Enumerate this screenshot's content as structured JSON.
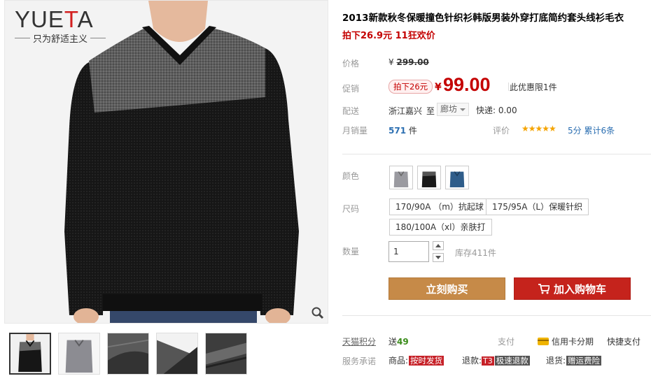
{
  "gallery": {
    "brand_prefix": "YUE",
    "brand_accent": "T",
    "brand_suffix": "A",
    "tagline": "只为舒适主义",
    "zoom_icon": "magnifier-icon",
    "thumbnails": [
      "front-view",
      "grey-sweater",
      "knit-texture-1",
      "knit-texture-2",
      "knit-texture-3"
    ]
  },
  "product": {
    "title": "2013新款秋冬保暖撞色针织衫韩版男装外穿打底简约套头线衫毛衣",
    "promo_line": "拍下26.9元 11狂欢价"
  },
  "price": {
    "label": "价格",
    "currency": "¥",
    "original": "299.00",
    "promo_label": "促销",
    "promo_tag": "拍下26元",
    "current": "99.00",
    "limit": "此优惠限1件"
  },
  "shipping": {
    "label": "配送",
    "from": "浙江嘉兴",
    "to_word": "至",
    "destination": "廊坊",
    "fee": "快递: 0.00"
  },
  "sales": {
    "label": "月销量",
    "count": "571",
    "unit": "件",
    "rating_label": "评价",
    "stars": "★★★★★",
    "score": "5分",
    "reviews": "累计6条"
  },
  "color": {
    "label": "颜色",
    "swatches": [
      {
        "name": "grey",
        "hex": "#9a9aa0"
      },
      {
        "name": "black",
        "hex": "#1a1a1a"
      },
      {
        "name": "blue",
        "hex": "#2f5d8a"
      }
    ]
  },
  "size": {
    "label": "尺码",
    "options": [
      "170/90A （m）抗起球",
      "175/95A（L）保暖针织",
      "180/100A（xl）亲肤打"
    ]
  },
  "quantity": {
    "label": "数量",
    "value": "1",
    "stock": "库存411件"
  },
  "actions": {
    "buy": "立刻购买",
    "cart": "加入购物车"
  },
  "footer": {
    "points_label": "天猫积分",
    "points_prefix": "送",
    "points_value": "49",
    "pay_label": "支付",
    "card_pay": "信用卡分期",
    "quick_pay": "快捷支付",
    "service_label": "服务承诺",
    "goods_label": "商品:",
    "goods_badge": "按时发货",
    "refund_label": "退款:",
    "refund_badge_t3": "T3",
    "refund_badge": "极速退款",
    "return_label": "退货:",
    "return_badge": "赠运费险"
  },
  "colors": {
    "accent_red": "#c40000",
    "buy_orange": "#c68a48",
    "cart_red": "#c5231c",
    "link_blue": "#2c6fb2"
  }
}
